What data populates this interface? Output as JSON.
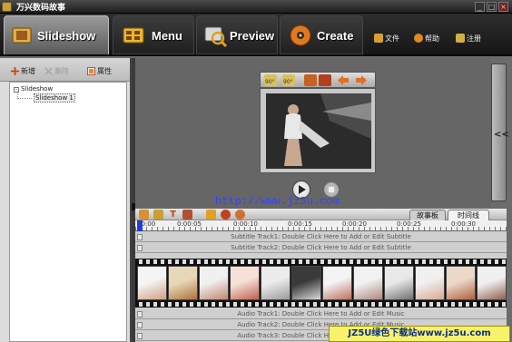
{
  "window": {
    "title": "万兴数码故事",
    "controls": [
      "_",
      "□",
      "×"
    ]
  },
  "nav": {
    "tabs": [
      {
        "label": "Slideshow",
        "active": true,
        "icon": "slideshow-icon"
      },
      {
        "label": "Menu",
        "active": false,
        "icon": "menu-icon"
      },
      {
        "label": "Preview",
        "active": false,
        "icon": "preview-icon"
      },
      {
        "label": "Create",
        "active": false,
        "icon": "disc-icon"
      }
    ],
    "links": [
      {
        "label": "文件",
        "icon": "file-icon"
      },
      {
        "label": "帮助",
        "icon": "help-icon"
      },
      {
        "label": "注册",
        "icon": "key-icon"
      }
    ]
  },
  "left_panel": {
    "toolbar": {
      "add": "新增",
      "delete": "删除",
      "properties": "属性"
    },
    "tree": {
      "root": "Slideshow",
      "children": [
        "Slideshow 1"
      ]
    }
  },
  "preview": {
    "toolbar_icons": [
      "rotate-left-90-icon",
      "rotate-right-90-icon",
      "crop-icon",
      "prev-icon",
      "next-icon"
    ],
    "rotate_left_label": "90°",
    "rotate_right_label": "90°",
    "watermark_url": "http://www.jz5u.com",
    "expand_arrow": "<<"
  },
  "timeline": {
    "tabs": {
      "storyboard": "故事板",
      "timeline": "时间线"
    },
    "ruler_ticks": [
      "00:00",
      "0:00:05",
      "0:00:10",
      "0:00:15",
      "0:00:20",
      "0:00:25",
      "0:00:30"
    ],
    "subtitle_tracks": [
      "Subtitle Track1: Double Click Here to Add or Edit Subtitle",
      "Subtitle Track2: Double Click Here to Add or Edit Subtitle"
    ],
    "audio_tracks": [
      "Audio Track1: Double Click Here to Add or Edit Music",
      "Audio Track2: Double Click Here to Add or Edit Music",
      "Audio Track3: Double Click Here to Add or Edit Music"
    ]
  },
  "watermark_banner": "JZ5U绿色下载站www.jz5u.com",
  "colors": {
    "accent_blue": "#1e3cdc",
    "watermark_yellow": "#f7f26a",
    "active_tab": "#8a8a8a"
  }
}
